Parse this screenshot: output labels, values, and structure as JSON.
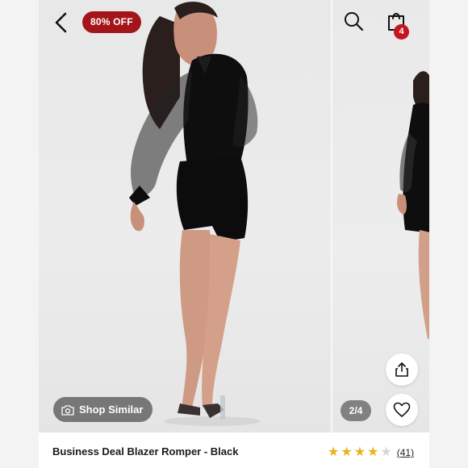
{
  "header": {
    "back_icon": "chevron-left-icon",
    "discount_badge": "80% OFF",
    "search_icon": "search-icon",
    "bag_icon": "shopping-bag-icon",
    "bag_count": "4"
  },
  "gallery": {
    "page_indicator": "2/4",
    "shop_similar_label": "Shop Similar",
    "shop_similar_icon": "camera-icon",
    "share_icon": "share-icon",
    "wishlist_icon": "heart-icon"
  },
  "product": {
    "title": "Business Deal Blazer Romper - Black",
    "rating": 4,
    "rating_max": 5,
    "review_count": "(41)"
  },
  "colors": {
    "badge": "#a4151b",
    "bag_count": "#c4161f",
    "star_filled": "#e8b21c",
    "star_empty": "#d6d6d6"
  }
}
